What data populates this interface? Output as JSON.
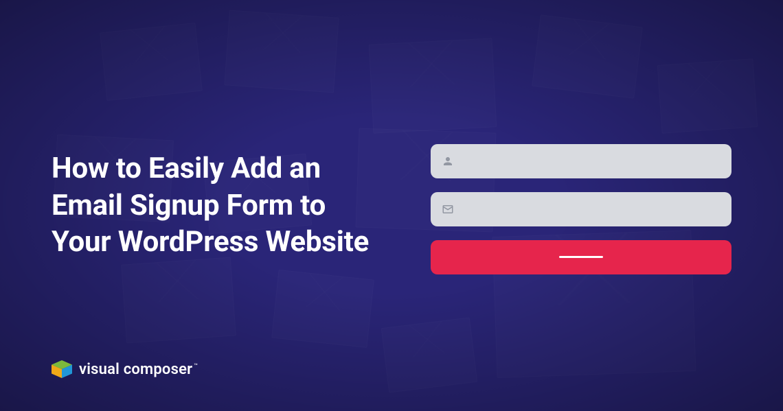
{
  "heading": "How to Easily Add an Email Signup Form to Your WordPress Website",
  "brand": {
    "name": "visual composer",
    "tm": "™"
  },
  "form": {
    "name_field": {
      "icon": "user-icon"
    },
    "email_field": {
      "icon": "mail-icon"
    },
    "submit": {
      "label": ""
    }
  },
  "colors": {
    "background": "#2a2578",
    "field": "#d9dbe0",
    "button": "#e6254c",
    "text": "#ffffff"
  }
}
